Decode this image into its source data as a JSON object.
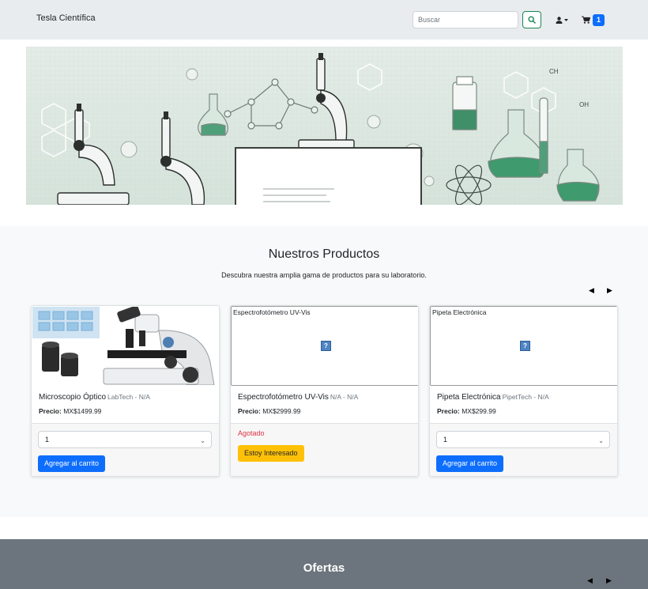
{
  "navbar": {
    "brand": "Tesla Científica",
    "search_placeholder": "Buscar",
    "search_icon": "magnifier-icon",
    "user_icon": "user-icon",
    "cart_icon": "cart-icon",
    "cart_count": "1"
  },
  "products": {
    "title": "Nuestros Productos",
    "subtitle": "Descubra nuestra amplia gama de productos para su laboratorio.",
    "items": [
      {
        "name": "Microscopio Óptico",
        "brand": "LabTech - N/A",
        "price_label": "Precio:",
        "price": "MX$1499.99",
        "image_alt": "",
        "qty": "1",
        "action": "Agregar al carrito"
      },
      {
        "name": "Espectrofotómetro UV-Vis",
        "brand": "N/A - N/A",
        "price_label": "Precio:",
        "price": "MX$2999.99",
        "image_alt": "Espectrofotómetro UV-Vis",
        "status": "Agotado",
        "action": "Estoy Interesado"
      },
      {
        "name": "Pipeta Electrónica",
        "brand": "PipetTech - N/A",
        "price_label": "Precio:",
        "price": "MX$299.99",
        "image_alt": "Pipeta Electrónica",
        "qty": "1",
        "action": "Agregar al carrito"
      }
    ]
  },
  "offers": {
    "title": "Ofertas"
  },
  "colors": {
    "primary": "#0d6efd",
    "success": "#198754",
    "warning": "#ffc107",
    "danger": "#dc3545",
    "secondary": "#6c757d"
  }
}
